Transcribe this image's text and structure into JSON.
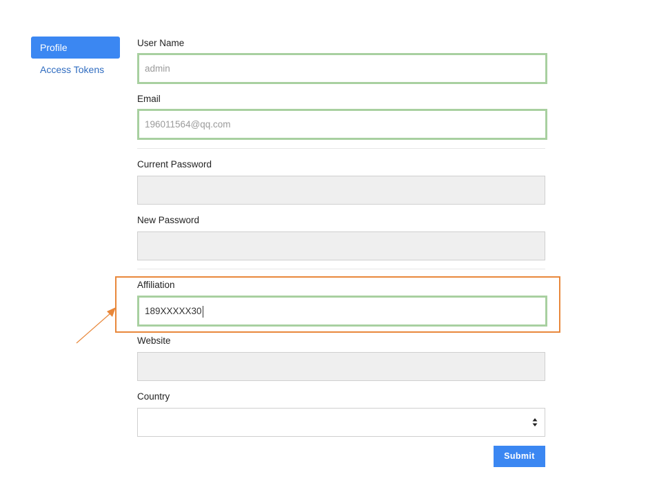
{
  "sidebar": {
    "items": [
      {
        "label": "Profile",
        "active": true
      },
      {
        "label": "Access Tokens",
        "active": false
      }
    ]
  },
  "form": {
    "username": {
      "label": "User Name",
      "value": "admin"
    },
    "email": {
      "label": "Email",
      "value": "196011564@qq.com"
    },
    "current_password": {
      "label": "Current Password",
      "value": ""
    },
    "new_password": {
      "label": "New Password",
      "value": ""
    },
    "affiliation": {
      "label": "Affiliation",
      "value": "189XXXXX30"
    },
    "website": {
      "label": "Website",
      "value": ""
    },
    "country": {
      "label": "Country",
      "value": ""
    },
    "submit_label": "Submit"
  },
  "colors": {
    "accent": "#3b87f2",
    "valid_border": "#a8d0a0",
    "annotation": "#e8873a"
  },
  "icons": {
    "select_arrows": "updown-arrows-icon",
    "annotation_arrow": "arrow-icon"
  }
}
